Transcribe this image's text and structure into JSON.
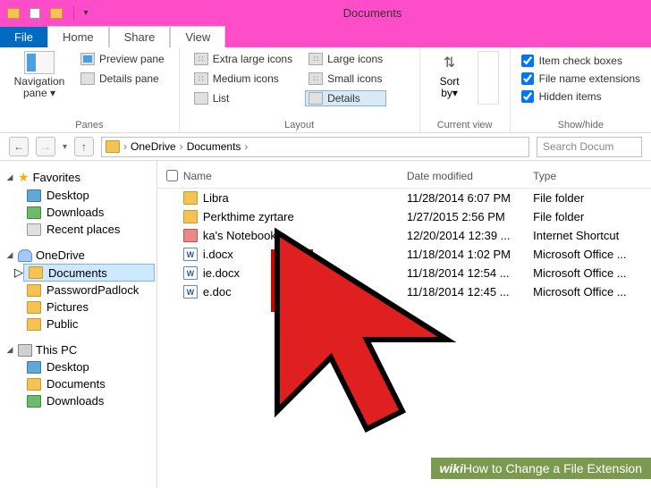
{
  "window": {
    "title": "Documents"
  },
  "tabs": {
    "file": "File",
    "home": "Home",
    "share": "Share",
    "view": "View",
    "active": "View"
  },
  "ribbon": {
    "panes": {
      "navigation": "Navigation\npane ▾",
      "preview": "Preview pane",
      "details": "Details pane",
      "label": "Panes"
    },
    "layout": {
      "extralarge": "Extra large icons",
      "large": "Large icons",
      "medium": "Medium icons",
      "small": "Small icons",
      "list": "List",
      "details": "Details",
      "label": "Layout"
    },
    "currentview": {
      "sort": "Sort\nby▾",
      "label": "Current view"
    },
    "showhide": {
      "itemcheck": "Item check boxes",
      "fileext": "File name extensions",
      "hidden": "Hidden items",
      "label": "Show/hide"
    }
  },
  "address": {
    "crumbs": [
      "OneDrive",
      "Documents"
    ],
    "search_placeholder": "Search Docum"
  },
  "sidebar": {
    "favorites": {
      "label": "Favorites",
      "items": [
        "Desktop",
        "Downloads",
        "Recent places"
      ]
    },
    "onedrive": {
      "label": "OneDrive",
      "items": [
        "Documents",
        "PasswordPadlock",
        "Pictures",
        "Public"
      ],
      "selected": 0
    },
    "thispc": {
      "label": "This PC",
      "items": [
        "Desktop",
        "Documents",
        "Downloads"
      ]
    }
  },
  "filelist": {
    "columns": {
      "name": "Name",
      "date": "Date modified",
      "type": "Type"
    },
    "rows": [
      {
        "icon": "folder",
        "name": "Libra",
        "date": "11/28/2014 6:07 PM",
        "type": "File folder"
      },
      {
        "icon": "folder",
        "name": "Perkthime zyrtare",
        "date": "1/27/2015 2:56 PM",
        "type": "File folder"
      },
      {
        "icon": "shortcut",
        "name": "ka's Notebook",
        "date": "12/20/2014 12:39 ...",
        "type": "Internet Shortcut"
      },
      {
        "icon": "doc",
        "name": "i.docx",
        "date": "11/18/2014 1:02 PM",
        "type": "Microsoft Office ..."
      },
      {
        "icon": "doc",
        "name": "ie.docx",
        "date": "11/18/2014 12:54 ...",
        "type": "Microsoft Office ..."
      },
      {
        "icon": "doc",
        "name": "e.doc",
        "date": "11/18/2014 12:45 ...",
        "type": "Microsoft Office ..."
      }
    ]
  },
  "caption": {
    "prefix": "wiki",
    "text": "How to Change a File Extension"
  }
}
